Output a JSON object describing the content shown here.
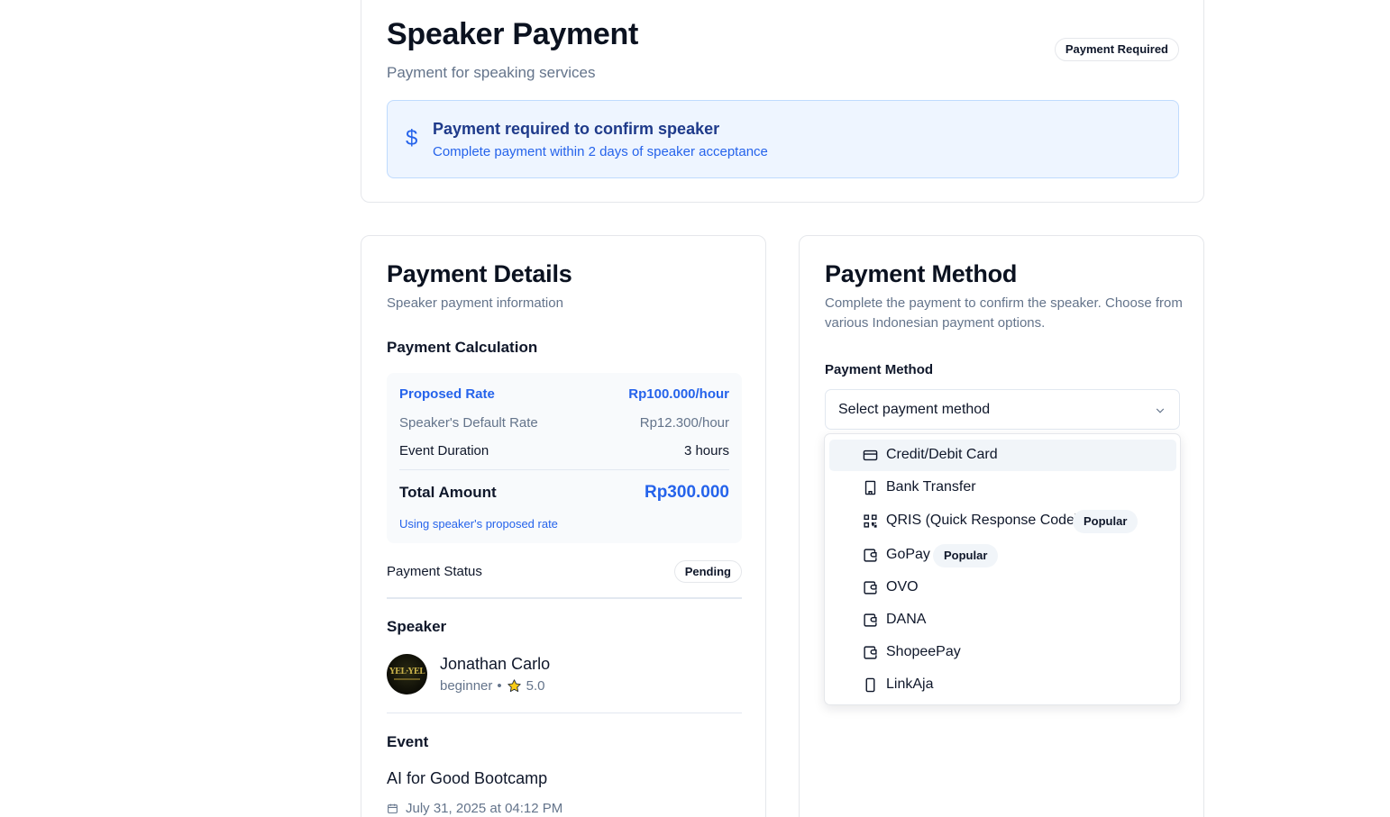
{
  "header": {
    "title": "Speaker Payment",
    "subtitle": "Payment for speaking services",
    "badge": "Payment Required",
    "alert": {
      "icon": "dollar-icon",
      "symbol": "$",
      "title": "Payment required to confirm speaker",
      "description": "Complete payment within 2 days of speaker acceptance"
    }
  },
  "details": {
    "title": "Payment Details",
    "subtitle": "Speaker payment information",
    "calc_title": "Payment Calculation",
    "rows": {
      "proposed": {
        "label": "Proposed Rate",
        "value": "Rp100.000/hour"
      },
      "default": {
        "label": "Speaker's Default Rate",
        "value": "Rp12.300/hour"
      },
      "duration": {
        "label": "Event Duration",
        "value": "3 hours"
      }
    },
    "total": {
      "label": "Total Amount",
      "value": "Rp300.000"
    },
    "note": "Using speaker's proposed rate",
    "status": {
      "label": "Payment Status",
      "value": "Pending"
    },
    "speaker": {
      "section_title": "Speaker",
      "name": "Jonathan Carlo",
      "level": "beginner",
      "separator": "•",
      "rating": "5.0"
    },
    "event": {
      "section_title": "Event",
      "name": "AI for Good Bootcamp",
      "date": "July 31, 2025 at 04:12 PM"
    }
  },
  "method": {
    "title": "Payment Method",
    "subtitle": "Complete the payment to confirm the speaker. Choose from various Indonesian payment options.",
    "field_label": "Payment Method",
    "placeholder": "Select payment method",
    "options": [
      {
        "label": "Credit/Debit Card",
        "icon": "credit-card-icon",
        "badge": "",
        "highlighted": true
      },
      {
        "label": "Bank Transfer",
        "icon": "bank-building-icon",
        "badge": ""
      },
      {
        "label": "QRIS (Quick Response Code)",
        "icon": "qr-code-icon",
        "badge": "Popular"
      },
      {
        "label": "GoPay",
        "icon": "wallet-icon",
        "badge": "Popular"
      },
      {
        "label": "OVO",
        "icon": "wallet-icon",
        "badge": ""
      },
      {
        "label": "DANA",
        "icon": "wallet-icon",
        "badge": ""
      },
      {
        "label": "ShopeePay",
        "icon": "wallet-icon",
        "badge": ""
      },
      {
        "label": "LinkAja",
        "icon": "smartphone-icon",
        "badge": ""
      }
    ]
  },
  "colors": {
    "accent": "#2563eb",
    "alert_bg": "#eef5ff",
    "muted": "#64748b",
    "star": "#facc15"
  }
}
